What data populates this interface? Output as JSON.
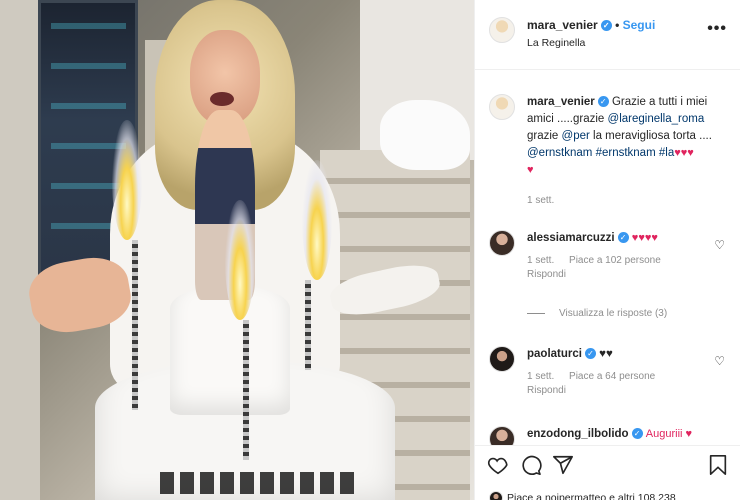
{
  "post": {
    "username": "mara_venier",
    "follow_label": "Segui",
    "location": "La Reginella",
    "more_label": "•••"
  },
  "caption": {
    "username": "mara_venier",
    "text_1": "Grazie a tutti i miei amici .....grazie ",
    "tag_1": "@lareginella_roma",
    "text_2": " grazie ",
    "tag_2": "@per",
    "text_3": " la meravigliosa torta .... ",
    "tag_3": "@ernstknam",
    "text_4": " ",
    "tag_4": "#ernstknam",
    "text_5": " ",
    "tag_5": "#la",
    "hearts": "♥♥♥",
    "hearts_2": "♥",
    "time": "1 sett."
  },
  "comments": [
    {
      "username": "alessiamarcuzzi",
      "text": "♥♥♥♥",
      "time": "1 sett.",
      "likes": "Piace a 102 persone",
      "reply": "Rispondi"
    },
    {
      "username": "paolaturci",
      "text": "♥♥",
      "time": "1 sett.",
      "likes": "Piace a 64 persone",
      "reply": "Rispondi"
    },
    {
      "username": "enzodong_ilbolido",
      "text": "Auguriii ♥"
    }
  ],
  "view_replies": "Visualizza le risposte (3)",
  "liked_by": "Piace a noipermatteo e altri 108.238",
  "icons": {
    "more": "more-icon",
    "verified": "verified-badge-icon",
    "heart": "heart-icon",
    "comment": "comment-icon",
    "share": "share-icon",
    "save": "bookmark-icon"
  },
  "colors": {
    "accent": "#3897f0",
    "heart_red": "#e0245e",
    "meta_grey": "#8e8e8e"
  }
}
